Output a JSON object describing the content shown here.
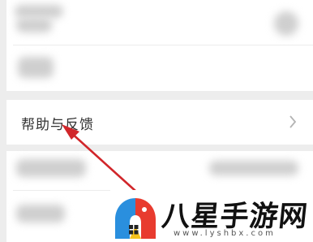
{
  "settings_menu": {
    "help_feedback_label": "帮助与反馈"
  },
  "watermark": {
    "brand_text": "八星手游网",
    "url_text": "www.lyshbx.com"
  },
  "icons": {
    "chevron": "chevron-right-icon",
    "logo": "bird-logo-icon",
    "taskbar": "windows-start-icon"
  },
  "colors": {
    "background": "#ededed",
    "card": "#ffffff",
    "arrow": "#d1262a",
    "logo_blue": "#2a8fde",
    "logo_red": "#e83b2f",
    "logo_yellow": "#f6c21b"
  }
}
